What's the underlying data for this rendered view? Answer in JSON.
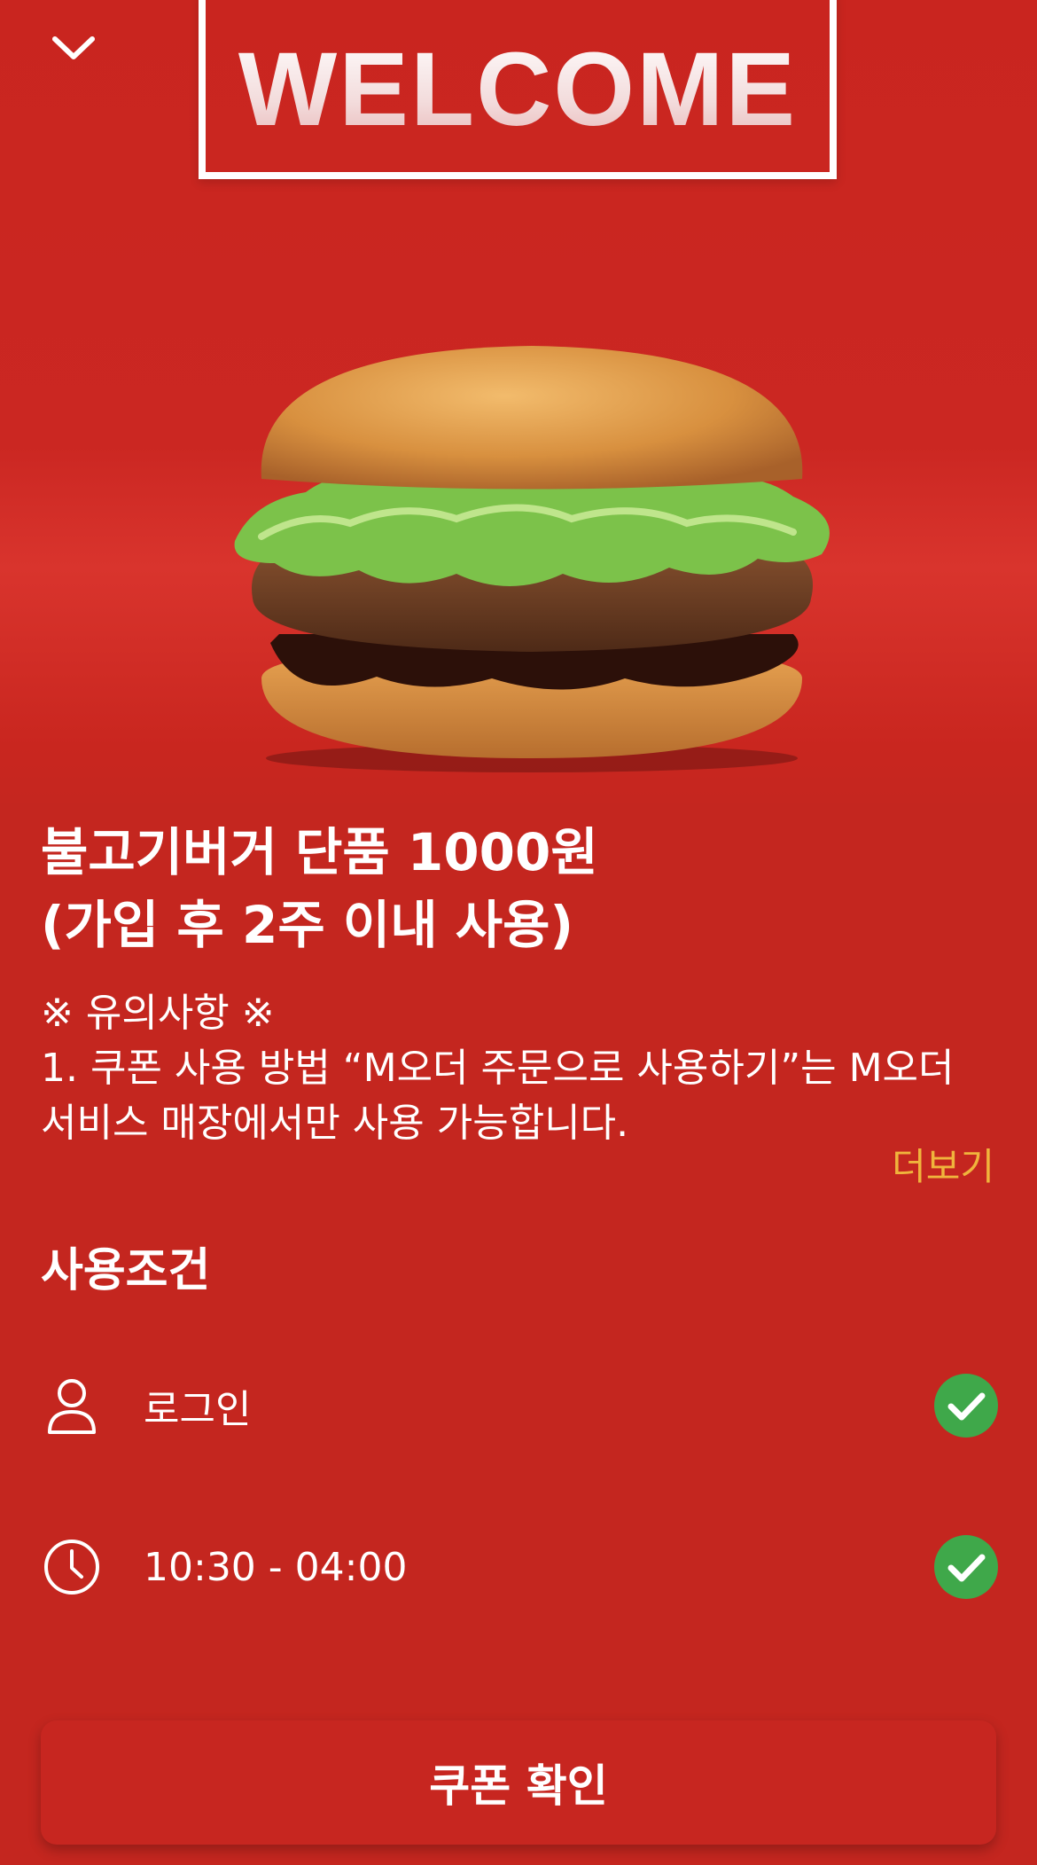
{
  "banner": {
    "welcome_text": "WELCOME"
  },
  "offer": {
    "title_line1": "불고기버거 단품 1000원",
    "title_line2": "(가입 후 2주 이내 사용)"
  },
  "notice": {
    "heading": "※ 유의사항 ※",
    "line1": "1. 쿠폰 사용 방법 “M오더 주문으로 사용하기”는 M오더",
    "line2": "서비스 매장에서만 사용 가능합니다.",
    "more_label": "더보기"
  },
  "conditions": {
    "title": "사용조건",
    "items": [
      {
        "icon": "person-icon",
        "label": "로그인",
        "status": "check"
      },
      {
        "icon": "clock-icon",
        "label": "10:30 - 04:00",
        "status": "check"
      }
    ]
  },
  "action": {
    "button_label": "쿠폰 확인"
  },
  "colors": {
    "background": "#c4261f",
    "accent_more": "#f0b43c",
    "check_green": "#3fa84a"
  }
}
